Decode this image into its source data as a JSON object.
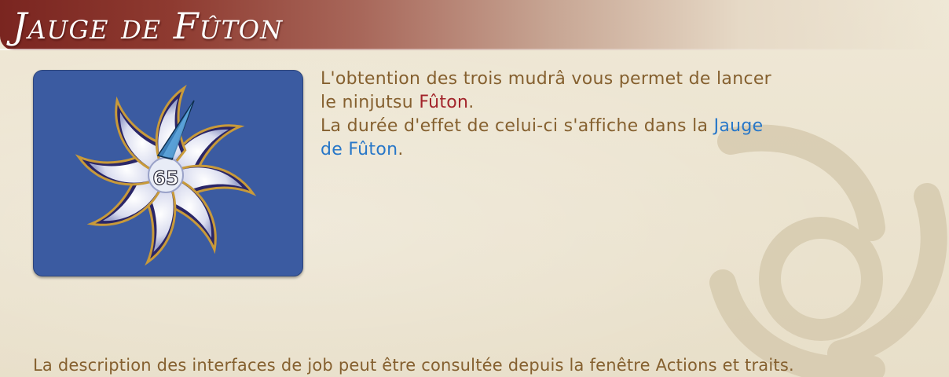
{
  "title": "Jauge de Fûton",
  "gauge": {
    "value": "65"
  },
  "description": {
    "line1": "L'obtention des trois mudrâ vous permet de lancer",
    "line2_prefix": "le ninjutsu ",
    "line2_highlight": "Fûton",
    "line2_suffix": ".",
    "line3_prefix": "La durée d'effet de celui-ci s'affiche dans la ",
    "line3_highlight": "Jauge",
    "line4_highlight": "de Fûton",
    "line4_suffix": "."
  },
  "footer": "La description des interfaces de job peut être consultée depuis la fenêtre Actions et traits.",
  "colors": {
    "text": "#85602f",
    "highlight_red": "#a2232a",
    "highlight_blue": "#2877c8",
    "panel_bg": "#3b5ba1",
    "header_red": "#7a2520"
  }
}
